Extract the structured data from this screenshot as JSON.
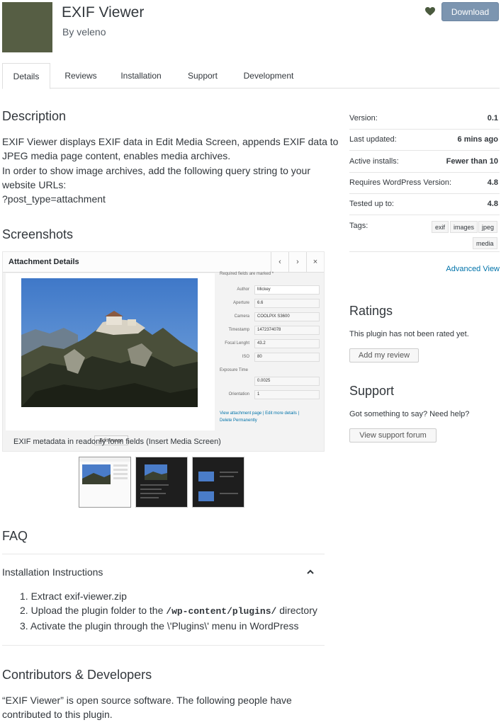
{
  "header": {
    "title": "EXIF Viewer",
    "byline": "By veleno",
    "download_label": "Download",
    "icon_color": "#565e44",
    "download_color": "#7c95b0"
  },
  "tabs": [
    "Details",
    "Reviews",
    "Installation",
    "Support",
    "Development"
  ],
  "description": {
    "heading": "Description",
    "line1": "EXIF Viewer displays EXIF data in Edit Media Screen, appends EXIF data to",
    "line2": "JPEG media page content, enables media archives.",
    "line3": "In order to show image archives, add the following query string to your",
    "line4": "website URLs:",
    "line5": "?post_type=attachment"
  },
  "screenshots": {
    "heading": "Screenshots",
    "modal_title": "Attachment Details",
    "nav_prev": "‹",
    "nav_next": "›",
    "close": "×",
    "required_note": "Required fields are marked *",
    "edit_image": "Edit Image",
    "fields": [
      {
        "label": "Author",
        "value": "Mickey"
      },
      {
        "label": "Aperture",
        "value": "6.6"
      },
      {
        "label": "Camera",
        "value": "COOLPIX S3600"
      },
      {
        "label": "Timestamp",
        "value": "1472374078"
      },
      {
        "label": "Focal Lenght",
        "value": "43.2"
      },
      {
        "label": "ISO",
        "value": "80"
      },
      {
        "label": "Exposure Time",
        "value": "0.0025"
      },
      {
        "label": "Orientation",
        "value": "1"
      }
    ],
    "links": "View attachment page | Edit more details |",
    "delete": "Delete Permanently",
    "caption": "EXIF metadata in readonly form fields (Insert Media Screen)"
  },
  "faq": {
    "heading": "FAQ",
    "question": "Installation Instructions",
    "steps": [
      {
        "n": "1.",
        "pre": "Extract exif-viewer.zip",
        "code": "",
        "post": ""
      },
      {
        "n": "2.",
        "pre": "Upload the plugin folder to the ",
        "code": "/wp-content/plugins/",
        "post": " directory"
      },
      {
        "n": "3.",
        "pre": "Activate the plugin through the \\'Plugins\\' menu in WordPress",
        "code": "",
        "post": ""
      }
    ]
  },
  "contributors": {
    "heading": "Contributors & Developers",
    "line1": "“EXIF Viewer” is open source software. The following people have",
    "line2": "contributed to this plugin."
  },
  "sidebar": {
    "meta": [
      {
        "k": "Version:",
        "v": "0.1"
      },
      {
        "k": "Last updated:",
        "v": "6 mins ago"
      },
      {
        "k": "Active installs:",
        "v": "Fewer than 10"
      },
      {
        "k": "Requires WordPress Version:",
        "v": "4.8"
      },
      {
        "k": "Tested up to:",
        "v": "4.8"
      }
    ],
    "tags_label": "Tags:",
    "tags": [
      "exif",
      "images",
      "jpeg",
      "media"
    ],
    "advanced_view": "Advanced View",
    "ratings_heading": "Ratings",
    "ratings_text": "This plugin has not been rated yet.",
    "add_review": "Add my review",
    "support_heading": "Support",
    "support_text": "Got something to say? Need help?",
    "support_button": "View support forum"
  }
}
